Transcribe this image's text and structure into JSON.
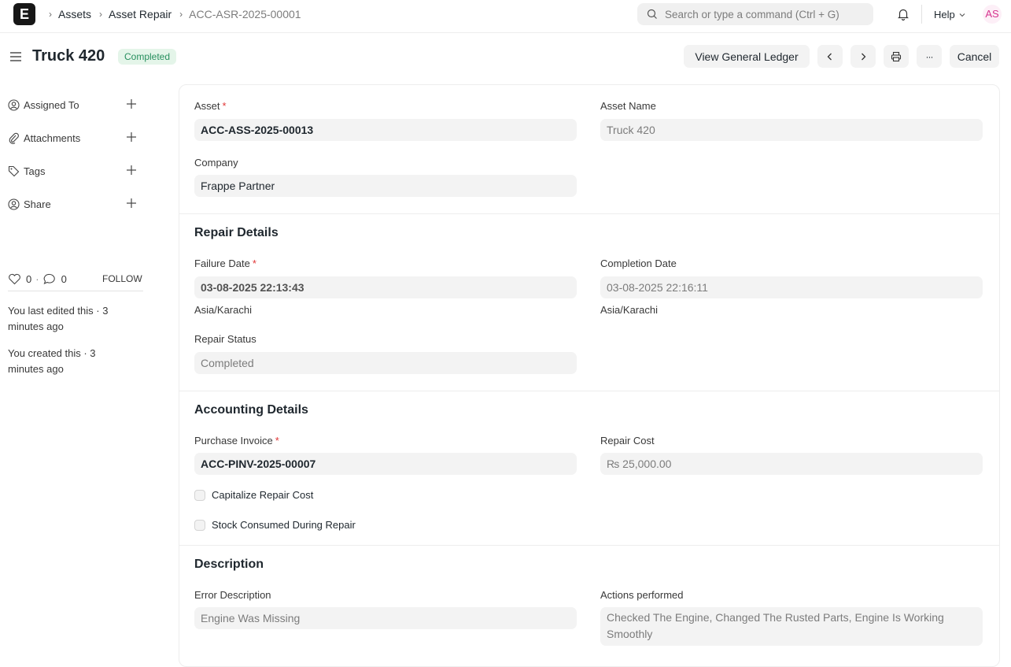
{
  "topbar": {
    "logo": "E",
    "breadcrumbs": [
      "Assets",
      "Asset Repair",
      "ACC-ASR-2025-00001"
    ],
    "search_placeholder": "Search or type a command (Ctrl + G)",
    "help_label": "Help",
    "avatar_initials": "AS"
  },
  "header": {
    "title": "Truck 420",
    "status": "Completed",
    "view_ledger_label": "View General Ledger",
    "more_label": "···",
    "cancel_label": "Cancel"
  },
  "sidebar": {
    "items": [
      {
        "label": "Assigned To",
        "icon": "user-assign-icon"
      },
      {
        "label": "Attachments",
        "icon": "paperclip-icon"
      },
      {
        "label": "Tags",
        "icon": "tag-icon"
      },
      {
        "label": "Share",
        "icon": "share-user-icon"
      }
    ],
    "likes": "0",
    "comments": "0",
    "dot": "·",
    "follow_label": "FOLLOW",
    "last_edited": "You last edited this · 3 minutes ago",
    "created": "You created this · 3 minutes ago"
  },
  "form": {
    "asset_label": "Asset",
    "asset_value": "ACC-ASS-2025-00013",
    "asset_name_label": "Asset Name",
    "asset_name_value": "Truck 420",
    "company_label": "Company",
    "company_value": "Frappe Partner",
    "repair_details_title": "Repair Details",
    "failure_date_label": "Failure Date",
    "failure_date_value": "03-08-2025 22:13:43",
    "failure_tz": "Asia/Karachi",
    "completion_date_label": "Completion Date",
    "completion_date_value": "03-08-2025 22:16:11",
    "completion_tz": "Asia/Karachi",
    "repair_status_label": "Repair Status",
    "repair_status_value": "Completed",
    "accounting_title": "Accounting Details",
    "purchase_invoice_label": "Purchase Invoice",
    "purchase_invoice_value": "ACC-PINV-2025-00007",
    "repair_cost_label": "Repair Cost",
    "repair_cost_value": "₨ 25,000.00",
    "capitalize_label": "Capitalize Repair Cost",
    "stock_consumed_label": "Stock Consumed During Repair",
    "description_title": "Description",
    "error_description_label": "Error Description",
    "error_description_value": "Engine Was Missing",
    "actions_performed_label": "Actions performed",
    "actions_performed_value": "Checked The Engine, Changed The Rusted Parts, Engine Is Working Smoothly",
    "required_mark": "*"
  },
  "colors": {
    "status_green_bg": "#e4f5e9",
    "status_green_text": "#278f5e",
    "required_red": "#e03636",
    "avatar_pink": "#d6338e"
  }
}
